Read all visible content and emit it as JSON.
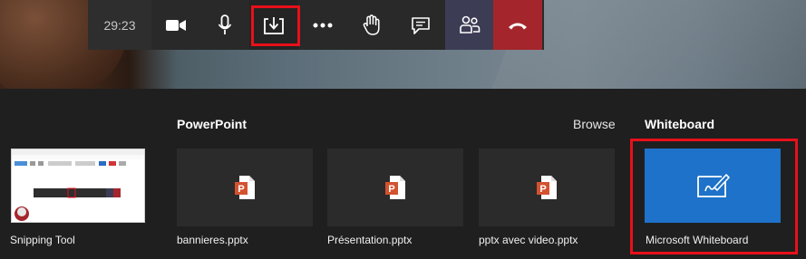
{
  "call_toolbar": {
    "timer": "29:23",
    "buttons": [
      {
        "icon": "video-camera-icon"
      },
      {
        "icon": "microphone-icon"
      },
      {
        "icon": "share-tray-icon",
        "highlighted": true
      },
      {
        "icon": "more-options-icon"
      },
      {
        "icon": "raise-hand-icon"
      },
      {
        "icon": "chat-icon"
      },
      {
        "icon": "participants-icon"
      },
      {
        "icon": "hang-up-icon"
      }
    ],
    "colors": {
      "hangup": "#a4262c",
      "participants": "#3c3c55",
      "highlight": "#e8101a"
    }
  },
  "share_tray": {
    "window_item": {
      "label": "Snipping Tool"
    },
    "powerpoint": {
      "title": "PowerPoint",
      "browse_label": "Browse",
      "files": [
        {
          "name": "bannieres.pptx"
        },
        {
          "name": "Présentation.pptx"
        },
        {
          "name": "pptx avec video.pptx"
        }
      ]
    },
    "whiteboard": {
      "title": "Whiteboard",
      "item_label": "Microsoft Whiteboard",
      "highlighted": true,
      "tile_color": "#1e72c9"
    }
  }
}
